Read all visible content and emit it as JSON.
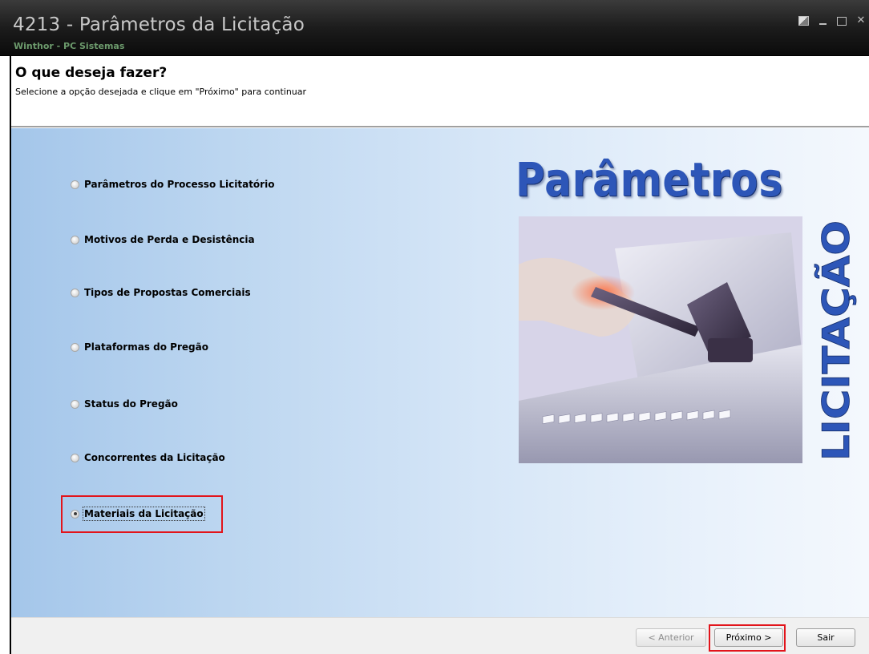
{
  "window": {
    "title": "4213 - Parâmetros da Licitação",
    "subtitle": "Winthor - PC Sistemas"
  },
  "header": {
    "title": "O que deseja fazer?",
    "description": "Selecione a opção desejada e clique em \"Próximo\" para continuar"
  },
  "options": [
    {
      "label": "Parâmetros do Processo Licitatório",
      "checked": false
    },
    {
      "label": "Motivos de Perda e Desistência",
      "checked": false
    },
    {
      "label": "Tipos de Propostas Comerciais",
      "checked": false
    },
    {
      "label": "Plataformas do Pregão",
      "checked": false
    },
    {
      "label": "Status do Pregão",
      "checked": false
    },
    {
      "label": "Concorrentes da Licitação",
      "checked": false
    },
    {
      "label": "Materiais da Licitação",
      "checked": true
    }
  ],
  "graphic": {
    "title": "Parâmetros",
    "vertical_word": "LICITAÇÃO"
  },
  "footer": {
    "previous_label": "< Anterior",
    "next_label": "Próximo >",
    "exit_label": "Sair"
  },
  "colors": {
    "highlight": "#e2141b",
    "title_blue": "#2d56b8"
  },
  "icons": [
    "restore-icon",
    "minimize-icon",
    "maximize-icon",
    "close-icon",
    "radio-icon"
  ]
}
